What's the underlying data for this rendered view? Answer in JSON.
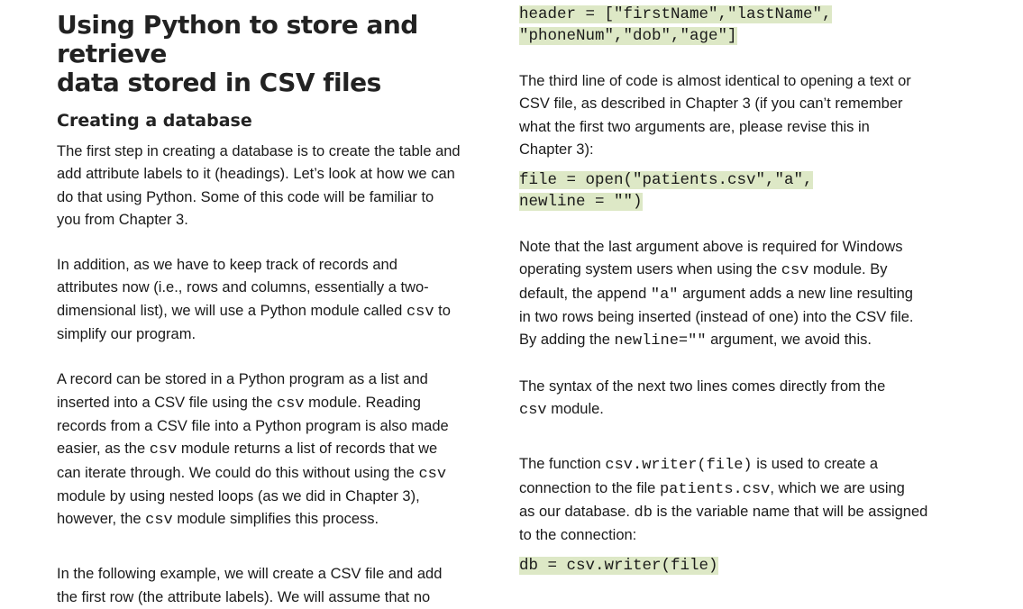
{
  "left": {
    "title_line1": "Using Python to store and retrieve",
    "title_line2": "data stored in CSV files",
    "subheading": "Creating a database",
    "para1": [
      "The first step in creating a database is to create the table and",
      "add attribute labels to it (headings). Let’s look at how we can",
      "do that using Python. Some of this code will be familiar to",
      "you from Chapter 3."
    ],
    "para2": {
      "l1": "In addition, as we have to keep track of records and",
      "l2": "attributes now (i.e., rows and columns, essentially a two-",
      "l3_pre": "dimensional list), we will use a Python module called ",
      "l3_code": "csv",
      "l3_post": " to",
      "l4": "simplify our program."
    },
    "para3": {
      "l1": "A record can be stored in a Python program as a list and",
      "l2_pre": "inserted into a CSV file using the ",
      "l2_code": "csv",
      "l2_post": " module. Reading",
      "l3": "records from a CSV file into a Python program is also made",
      "l4_pre": "easier, as the ",
      "l4_code": "csv",
      "l4_post": " module returns a list of records that we",
      "l5_pre": "can iterate through. We could do this without using the ",
      "l5_code": "csv",
      "l6": "module by using nested loops (as we did in Chapter 3),",
      "l7_pre": "however, the ",
      "l7_code": "csv",
      "l7_post": " module simplifies this process."
    },
    "para4": [
      "In the following example, we will create a CSV file and add",
      "the first row (the attribute labels). We will assume that no"
    ]
  },
  "right": {
    "code1": [
      "header = [\"firstName\",\"lastName\",",
      "\"phoneNum\",\"dob\",\"age\"]"
    ],
    "para1": [
      "The third line of code is almost identical to opening a text or",
      "CSV file, as described in Chapter 3 (if you can’t remember",
      "what the first two arguments are, please revise this in",
      "Chapter 3):"
    ],
    "code2": [
      "file = open(\"patients.csv\",\"a\",",
      "newline = \"\")"
    ],
    "para2": {
      "l1": "Note that the last argument above is required for Windows",
      "l2_pre": "operating system users when using the ",
      "l2_code": "csv",
      "l2_post": " module. By",
      "l3_pre": "default, the append ",
      "l3_code": "\"a\"",
      "l3_post": " argument adds a new line resulting",
      "l4": "in two rows being inserted (instead of one) into the CSV file.",
      "l5_pre": "By adding the ",
      "l5_code": "newline=\"\"",
      "l5_post": " argument, we avoid this."
    },
    "para3": {
      "l1": "The syntax of the next two lines comes directly from the",
      "l2_code": "csv",
      "l2_post": " module."
    },
    "para4": {
      "l1_pre": "The function ",
      "l1_code": "csv.writer(file)",
      "l1_post": " is used to create a",
      "l2_pre": "connection to the file ",
      "l2_code": "patients.csv",
      "l2_post": ", which we are using",
      "l3_pre": "as our database. ",
      "l3_code": "db",
      "l3_post": " is the variable name that will be assigned",
      "l4": "to the connection:"
    },
    "code3": "db = csv.writer(file)"
  }
}
